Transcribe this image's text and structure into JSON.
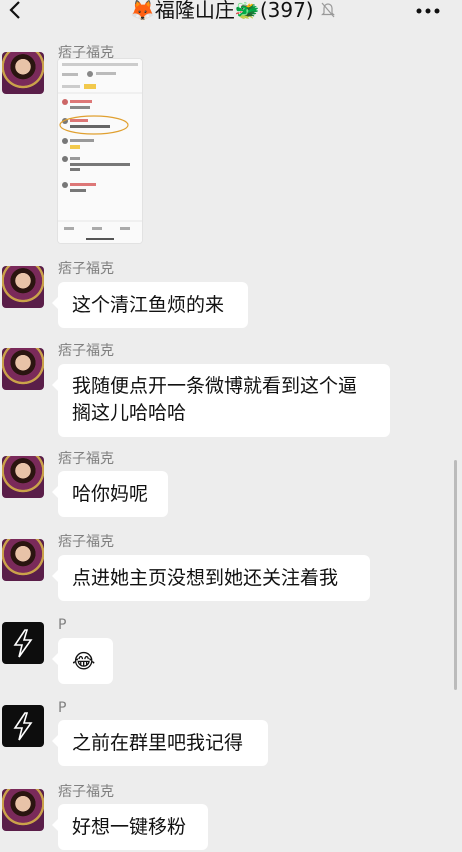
{
  "header": {
    "group_name": "福隆山庄",
    "member_count": "(397)",
    "left_emoji": "🦊",
    "right_emoji": "🐲"
  },
  "messages": [
    {
      "sender": "痞子福克",
      "type": "image"
    },
    {
      "sender": "痞子福克",
      "text": "这个清江鱼烦的来"
    },
    {
      "sender": "痞子福克",
      "text_line1": "我随便点开一条微博就看到这个逼",
      "text_line2": "搁这儿哈哈哈"
    },
    {
      "sender": "痞子福克",
      "text": "哈你妈呢"
    },
    {
      "sender": "痞子福克",
      "text": "点进她主页没想到她还关注着我"
    },
    {
      "sender": "P",
      "text": "😂"
    },
    {
      "sender": "P",
      "text": "之前在群里吧我记得"
    },
    {
      "sender": "痞子福克",
      "text": "好想一键移粉"
    }
  ],
  "icons": {
    "back": "chevron-left-icon",
    "mute": "bell-muted-icon",
    "more": "more-icon",
    "lightning": "lightning-icon"
  }
}
